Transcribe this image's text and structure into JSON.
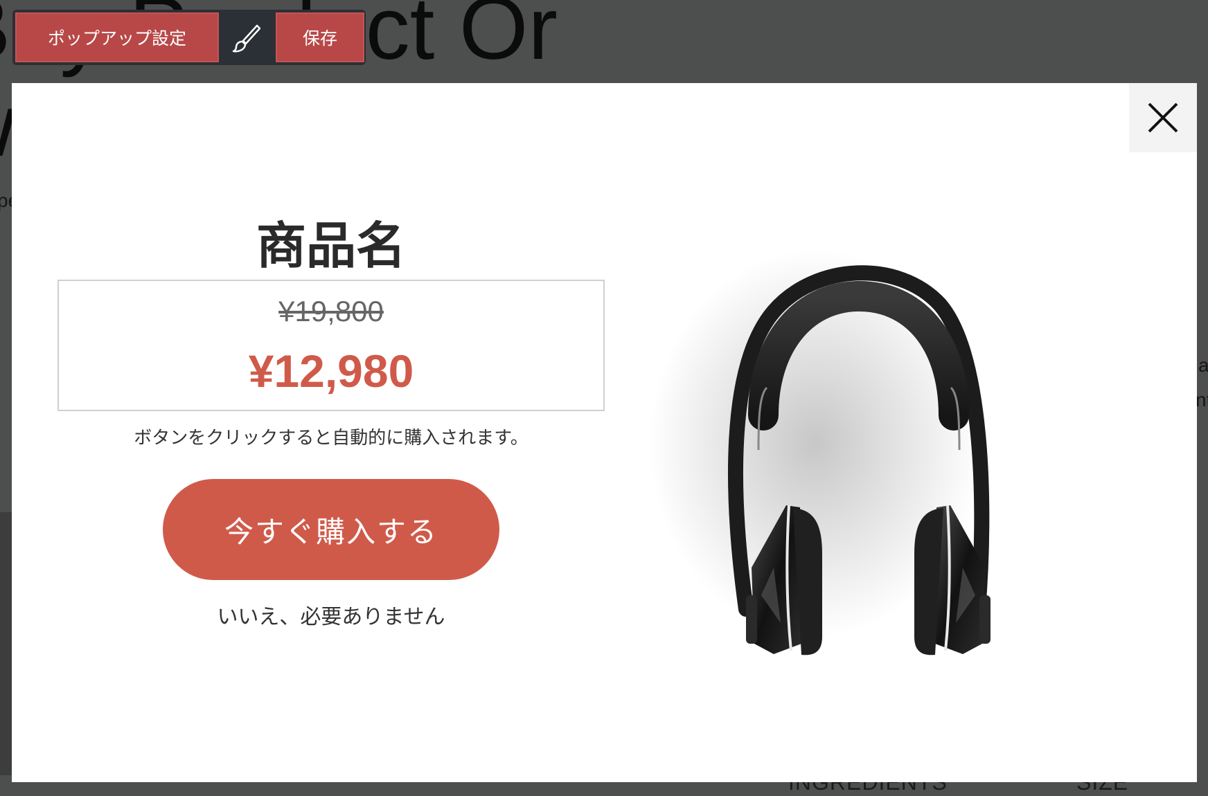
{
  "background_page": {
    "heading_line1": "Buy Product Or",
    "heading_line2": "w",
    "left_snippet": "pe",
    "right_snippet_1": "a",
    "right_snippet_2": "nt",
    "bottom_label_1": "INGREDIENTS",
    "bottom_label_2": "SIZE"
  },
  "toolbar": {
    "settings_label": "ポップアップ設定",
    "brush_icon": "brush-icon",
    "save_label": "保存",
    "accent_color": "#b84848"
  },
  "popup": {
    "close_icon": "close-icon",
    "product_name": "商品名",
    "original_price": "¥19,800",
    "sale_price": "¥12,980",
    "note": "ボタンをクリックすると自動的に購入されます。",
    "buy_button_label": "今すぐ購入する",
    "decline_label": "いいえ、必要ありません",
    "accent_color": "#d05a4a",
    "image_subject": "headphones"
  }
}
